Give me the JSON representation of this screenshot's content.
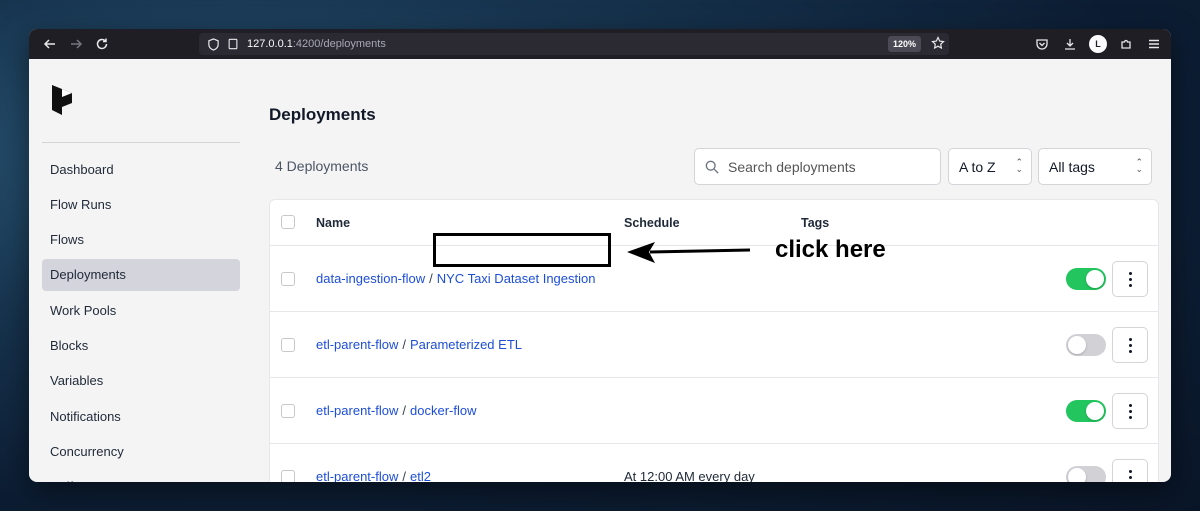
{
  "browser": {
    "url_host": "127.0.0.1",
    "url_path": ":4200/deployments",
    "zoom": "120%",
    "profile_initial": "L"
  },
  "sidebar": {
    "items": [
      {
        "label": "Dashboard"
      },
      {
        "label": "Flow Runs"
      },
      {
        "label": "Flows"
      },
      {
        "label": "Deployments",
        "active": true
      },
      {
        "label": "Work Pools"
      },
      {
        "label": "Blocks"
      },
      {
        "label": "Variables"
      },
      {
        "label": "Notifications"
      },
      {
        "label": "Concurrency"
      },
      {
        "label": "Artifacts"
      }
    ]
  },
  "main": {
    "title": "Deployments",
    "count": "4 Deployments",
    "search_placeholder": "Search deployments",
    "sort_value": "A to Z",
    "tags_value": "All tags"
  },
  "table": {
    "headers": {
      "name": "Name",
      "schedule": "Schedule",
      "tags": "Tags"
    },
    "rows": [
      {
        "flow": "data-ingestion-flow",
        "deployment": "NYC Taxi Dataset Ingestion",
        "schedule": "",
        "active": true
      },
      {
        "flow": "etl-parent-flow",
        "deployment": "Parameterized ETL",
        "schedule": "",
        "active": false
      },
      {
        "flow": "etl-parent-flow",
        "deployment": "docker-flow",
        "schedule": "",
        "active": true
      },
      {
        "flow": "etl-parent-flow",
        "deployment": "etl2",
        "schedule": "At 12:00 AM every day",
        "active": false
      }
    ],
    "separator": "/"
  },
  "annotation": {
    "text": "click here"
  },
  "colors": {
    "accent_link": "#1d4ed8",
    "toggle_on": "#22c55e",
    "toggle_off": "#d1d1d6"
  }
}
